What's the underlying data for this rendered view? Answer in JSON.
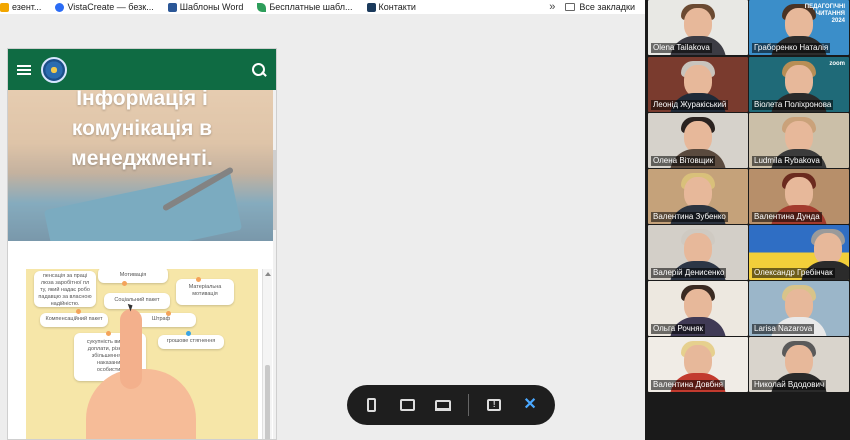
{
  "bookmarks": {
    "items": [
      {
        "label": "езент...",
        "icon": "presentation-icon",
        "color": "#f2a600"
      },
      {
        "label": "VistaCreate — безк...",
        "icon": "vistacreate-icon",
        "color": "#2b6cf5"
      },
      {
        "label": "Шаблоны Word",
        "icon": "template-icon",
        "color": "#2b5797"
      },
      {
        "label": "Бесплатные шабл...",
        "icon": "leaf-icon",
        "color": "#2e9e5b"
      },
      {
        "label": "Контакти",
        "icon": "contacts-icon",
        "color": "#1b3a5c"
      }
    ],
    "more": "»",
    "all_bookmarks": "Все закладки"
  },
  "phone": {
    "hero_title": "Інформація і комунікація в менеджменті.",
    "accent": "#0f6b43"
  },
  "video_cards": [
    "пенсація за праці\nлюза заробітної пл\nту, який надає робо\nпадавцю за власною\nнадійністю.",
    "Мотивація",
    "Матеріальна\nмотивація",
    "Компенсаційний пакет",
    "Соціальний пакет",
    "Штраф",
    "сукупність винаго-\nдоплати, різні ви-\nзбільшення та\nнаказаних\nособистих",
    "грошове стягнення"
  ],
  "toolbar": {
    "mobile": "mobile-view-icon",
    "tablet": "tablet-view-icon",
    "desktop": "laptop-view-icon",
    "feedback": "feedback-icon",
    "close": "✕"
  },
  "participants": [
    {
      "name": "Olena Tailakova"
    },
    {
      "name": "Грабоpенко Наталія",
      "badge": "ПЕДАГОГІЧНІ\nЧИТАННЯ\n2024"
    },
    {
      "name": "Леонід Жуpакіський"
    },
    {
      "name": "Віолета Поліхронова",
      "badge": "zoom"
    },
    {
      "name": "Олена Вітовщик"
    },
    {
      "name": "Ludmila Rybakova"
    },
    {
      "name": "Валентина Зубенко"
    },
    {
      "name": "Валентина Дунда"
    },
    {
      "name": "Валерій Денисенко"
    },
    {
      "name": "Олександр Гребінчак"
    },
    {
      "name": "Ольга Рочняк"
    },
    {
      "name": "Larisa Nazarova"
    },
    {
      "name": "Валентина Довбня"
    },
    {
      "name": "Николай Вдодович"
    }
  ]
}
